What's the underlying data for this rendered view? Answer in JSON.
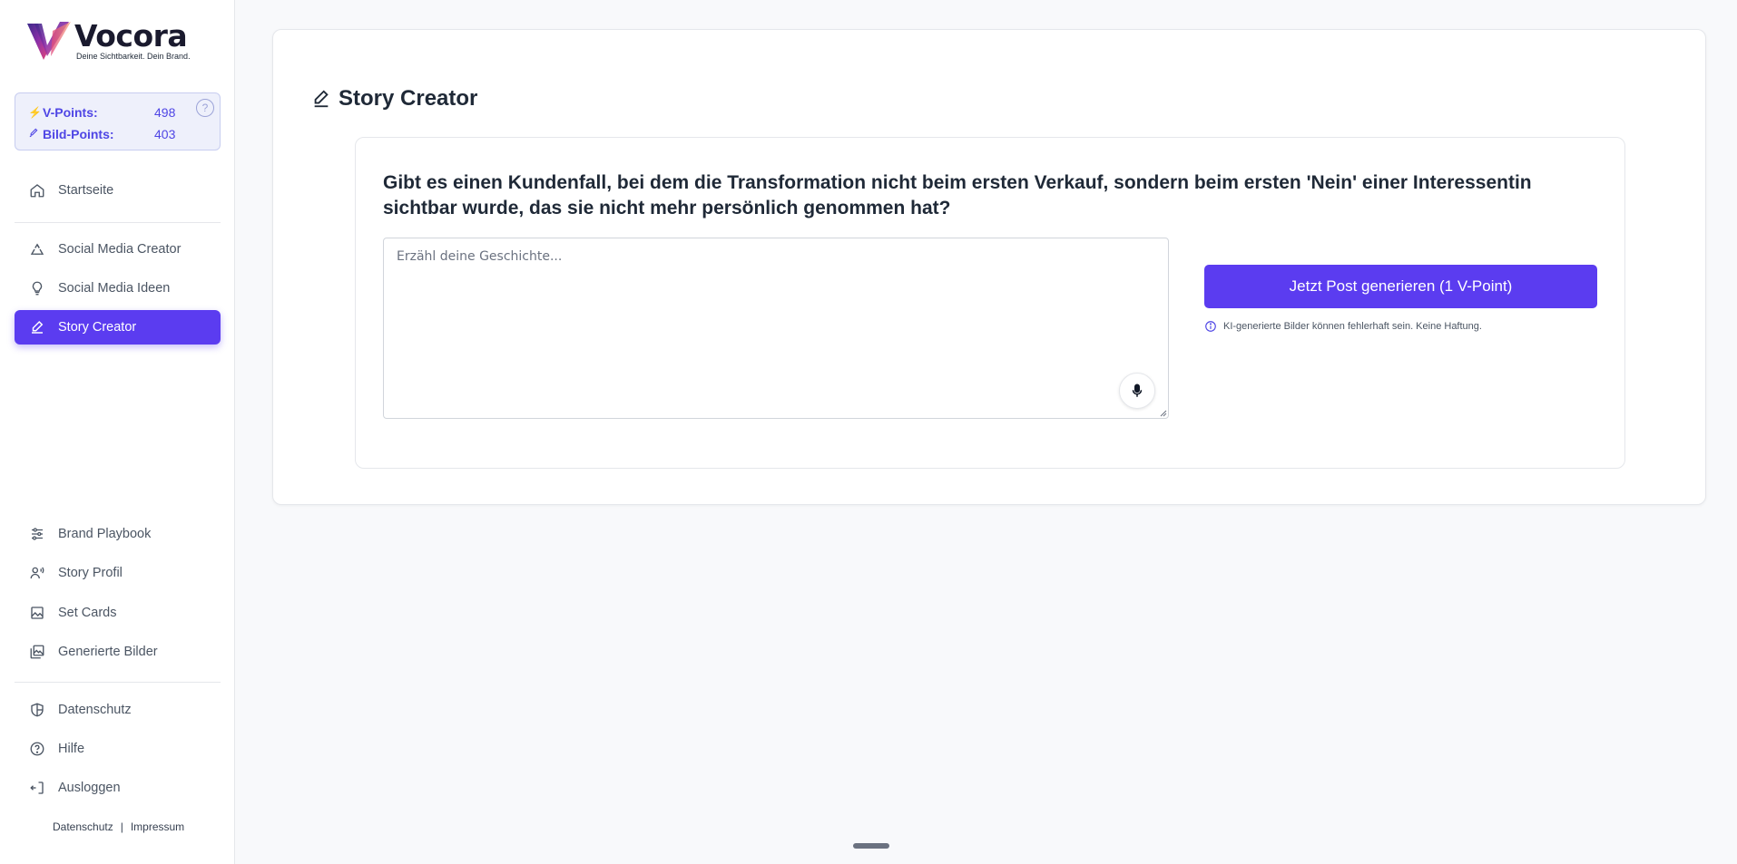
{
  "brand": {
    "name": "Vocora",
    "tagline": "Deine Sichtbarkeit. Dein Brand."
  },
  "points": {
    "v_label": "V-Points:",
    "v_value": "498",
    "bild_label": "Bild-Points:",
    "bild_value": "403",
    "help": "?"
  },
  "nav": {
    "home": "Startseite",
    "social_creator": "Social Media Creator",
    "social_ideas": "Social Media Ideen",
    "story_creator": "Story Creator",
    "brand_playbook": "Brand Playbook",
    "story_profil": "Story Profil",
    "set_cards": "Set Cards",
    "generated_images": "Generierte Bilder",
    "privacy": "Datenschutz",
    "help": "Hilfe",
    "logout": "Ausloggen"
  },
  "footer": {
    "privacy": "Datenschutz",
    "separator": "|",
    "imprint": "Impressum"
  },
  "main": {
    "title": "Story Creator",
    "question": "Gibt es einen Kundenfall, bei dem die Transformation nicht beim ersten Verkauf, sondern beim ersten 'Nein' einer Interessentin sichtbar wurde, das sie nicht mehr persönlich genommen hat?",
    "input_placeholder": "Erzähl deine Geschichte...",
    "input_value": "",
    "generate_button": "Jetzt Post generieren (1 V-Point)",
    "disclaimer": "KI-generierte Bilder können fehlerhaft sein. Keine Haftung."
  },
  "colors": {
    "accent": "#5b3cf0",
    "points_bg": "#eef0fb",
    "points_text": "#4f46e5"
  }
}
